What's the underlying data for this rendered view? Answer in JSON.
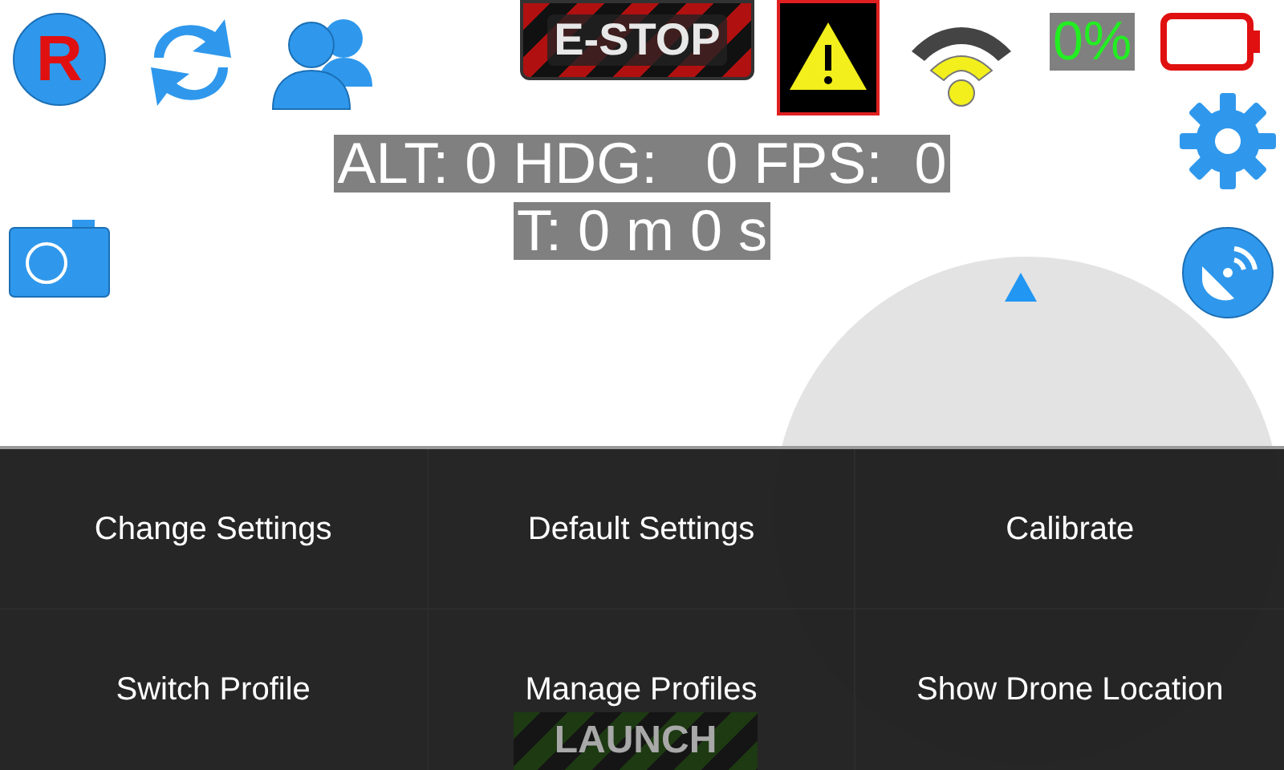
{
  "top_bar": {
    "record_label": "R",
    "estop_label": "E-STOP",
    "battery_percent": "0%"
  },
  "telemetry": {
    "line_1": "ALT: 0 HDG:   0 FPS:  0",
    "line_2": "T: 0 m 0 s"
  },
  "launch_button": {
    "label": "LAUNCH"
  },
  "menu": {
    "items": [
      {
        "label": "Change Settings"
      },
      {
        "label": "Default Settings"
      },
      {
        "label": "Calibrate"
      },
      {
        "label": "Switch Profile"
      },
      {
        "label": "Manage Profiles"
      },
      {
        "label": "Show Drone Location"
      }
    ]
  }
}
